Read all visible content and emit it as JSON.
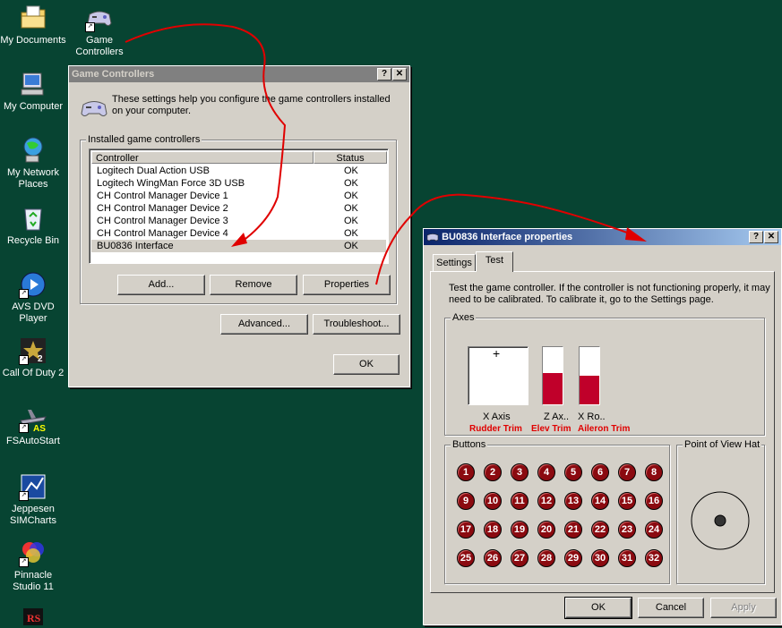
{
  "desktop": {
    "icons": [
      {
        "label": "My Documents",
        "icon": "folder-docs-icon"
      },
      {
        "label": "Game Controllers",
        "icon": "gamepad-icon"
      },
      {
        "label": "My Computer",
        "icon": "computer-icon"
      },
      {
        "label": "My Network Places",
        "icon": "network-icon"
      },
      {
        "label": "Recycle Bin",
        "icon": "recycle-bin-icon"
      },
      {
        "label": "AVS DVD Player",
        "icon": "dvd-player-icon"
      },
      {
        "label": "Call Of Duty 2",
        "icon": "cod2-icon"
      },
      {
        "label": "FSAutoStart",
        "icon": "plane-icon"
      },
      {
        "label": "Jeppesen SIMCharts",
        "icon": "charts-icon"
      },
      {
        "label": "Pinnacle Studio 11",
        "icon": "pinnacle-icon"
      }
    ],
    "colors": {
      "background": "#074432",
      "arrow": "#e00000"
    }
  },
  "game_controllers": {
    "title": "Game Controllers",
    "help_btn": "?",
    "close_btn": "✕",
    "intro": "These settings help you configure the game controllers installed on your computer.",
    "group_label": "Installed game controllers",
    "columns": [
      "Controller",
      "Status"
    ],
    "rows": [
      {
        "name": "Logitech Dual Action USB",
        "status": "OK"
      },
      {
        "name": "Logitech WingMan Force 3D USB",
        "status": "OK"
      },
      {
        "name": "CH Control Manager Device 1",
        "status": "OK"
      },
      {
        "name": "CH Control Manager Device 2",
        "status": "OK"
      },
      {
        "name": "CH Control Manager Device 3",
        "status": "OK"
      },
      {
        "name": "CH Control Manager Device 4",
        "status": "OK"
      },
      {
        "name": "BU0836 Interface",
        "status": "OK"
      }
    ],
    "selected_row": 6,
    "buttons": {
      "add": "Add...",
      "remove": "Remove",
      "properties": "Properties",
      "advanced": "Advanced...",
      "troubleshoot": "Troubleshoot...",
      "ok": "OK"
    }
  },
  "properties": {
    "title": "BU0836 Interface properties",
    "help_btn": "?",
    "close_btn": "✕",
    "tabs": [
      "Settings",
      "Test"
    ],
    "active_tab": "Test",
    "description": "Test the game controller.  If the controller is not functioning properly, it may need to be calibrated.  To calibrate it, go to the Settings page.",
    "axes_label": "Axes",
    "xy_axis_label": "X Axis",
    "z_axis_label": "Z Ax..",
    "xrot_label": "X Ro..",
    "annotations": {
      "rudder": "Rudder Trim",
      "elev": "Elev Trim",
      "aileron": "Aileron Trim"
    },
    "z_axis_level": 0.55,
    "xrot_level": 0.5,
    "buttons_label": "Buttons",
    "pov_label": "Point of View Hat",
    "button_numbers": [
      "1",
      "2",
      "3",
      "4",
      "5",
      "6",
      "7",
      "8",
      "9",
      "10",
      "11",
      "12",
      "13",
      "14",
      "15",
      "16",
      "17",
      "18",
      "19",
      "20",
      "21",
      "22",
      "23",
      "24",
      "25",
      "26",
      "27",
      "28",
      "29",
      "30",
      "31",
      "32"
    ],
    "footer": {
      "ok": "OK",
      "cancel": "Cancel",
      "apply": "Apply"
    }
  }
}
